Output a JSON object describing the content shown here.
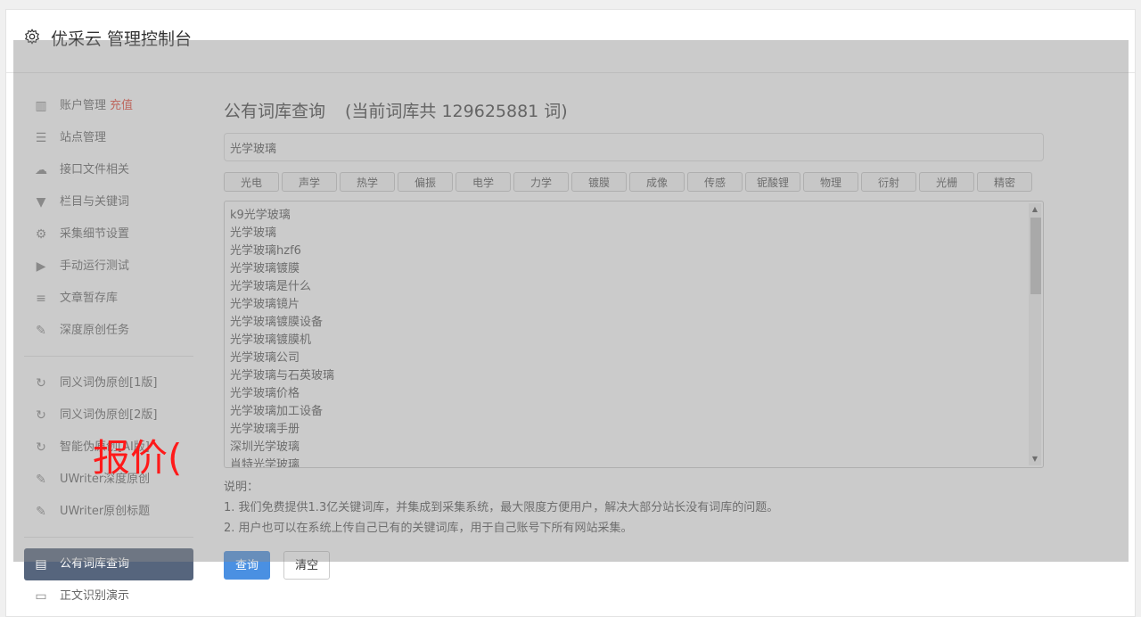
{
  "app": {
    "title": "优采云 管理控制台"
  },
  "sidebar": {
    "items": [
      {
        "label": "账户管理",
        "icon": "bar-chart-icon",
        "recharge": "充值"
      },
      {
        "label": "站点管理",
        "icon": "server-icon"
      },
      {
        "label": "接口文件相关",
        "icon": "cloud-upload-icon"
      },
      {
        "label": "栏目与关键词",
        "icon": "filter-icon"
      },
      {
        "label": "采集细节设置",
        "icon": "cogs-icon"
      },
      {
        "label": "手动运行测试",
        "icon": "play-circle-icon"
      },
      {
        "label": "文章暂存库",
        "icon": "database-icon"
      },
      {
        "label": "深度原创任务",
        "icon": "edit-icon"
      }
    ],
    "items2": [
      {
        "label": "同义词伪原创[1版]",
        "icon": "refresh-icon"
      },
      {
        "label": "同义词伪原创[2版]",
        "icon": "refresh-icon"
      },
      {
        "label": "智能伪原创[AI版]",
        "icon": "refresh-icon"
      },
      {
        "label": "UWriter深度原创",
        "icon": "edit-icon"
      },
      {
        "label": "UWriter原创标题",
        "icon": "edit-icon"
      }
    ],
    "items3": [
      {
        "label": "公有词库查询",
        "icon": "book-icon",
        "active": true
      },
      {
        "label": "正文识别演示",
        "icon": "monitor-icon"
      }
    ]
  },
  "main": {
    "title": "公有词库查询",
    "count_text": "(当前词库共 129625881 词)",
    "search_value": "光学玻璃",
    "tags": [
      "光电",
      "声学",
      "热学",
      "偏振",
      "电学",
      "力学",
      "镀膜",
      "成像",
      "传感",
      "铌酸锂",
      "物理",
      "衍射",
      "光栅",
      "精密"
    ],
    "results": [
      "k9光学玻璃",
      "光学玻璃",
      "光学玻璃hzf6",
      "光学玻璃镀膜",
      "光学玻璃是什么",
      "光学玻璃镜片",
      "光学玻璃镀膜设备",
      "光学玻璃镀膜机",
      "光学玻璃公司",
      "光学玻璃与石英玻璃",
      "光学玻璃价格",
      "光学玻璃加工设备",
      "光学玻璃手册",
      "深圳光学玻璃",
      "肖特光学玻璃"
    ],
    "notes": {
      "heading": "说明：",
      "line1": "1. 我们免费提供1.3亿关键词库，并集成到采集系统，最大限度方便用户，解决大部分站长没有词库的问题。",
      "line2": "2. 用户也可以在系统上传自己已有的关键词库，用于自己账号下所有网站采集。"
    },
    "buttons": {
      "query": "查询",
      "clear": "清空"
    }
  },
  "overlay_text": "报价(",
  "colors": {
    "accent": "#4a90e2",
    "active_nav": "#56657d",
    "recharge": "#e74c3c",
    "watermark": "#ff1a1a"
  }
}
